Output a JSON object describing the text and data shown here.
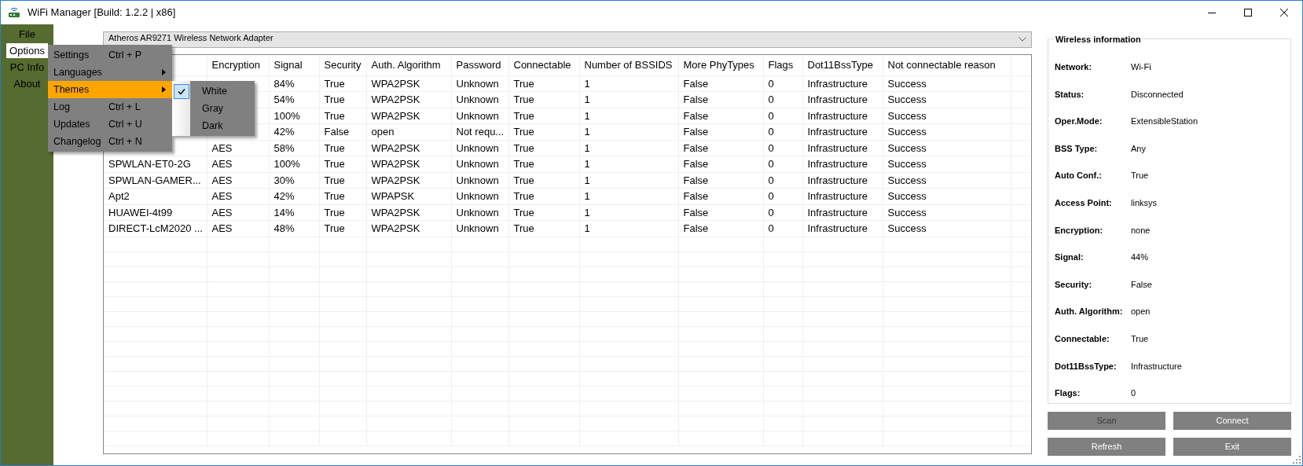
{
  "window": {
    "title": "WiFi Manager [Build: 1.2.2 | x86]"
  },
  "sidebar": {
    "items": [
      {
        "label": "File",
        "selected": false
      },
      {
        "label": "Options",
        "selected": true
      },
      {
        "label": "PC Info",
        "selected": false
      },
      {
        "label": "About",
        "selected": false
      }
    ]
  },
  "options_menu": {
    "items": [
      {
        "label": "Settings",
        "shortcut": "Ctrl + P",
        "kind": "command",
        "selected": false
      },
      {
        "label": "Languages",
        "kind": "submenu",
        "selected": false
      },
      {
        "label": "Themes",
        "kind": "submenu",
        "selected": true
      },
      {
        "label": "Log",
        "shortcut": "Ctrl + L",
        "kind": "command",
        "selected": false
      },
      {
        "label": "Updates",
        "shortcut": "Ctrl + U",
        "kind": "command",
        "selected": false
      },
      {
        "label": "Changelog",
        "shortcut": "Ctrl + N",
        "kind": "command",
        "selected": false
      }
    ]
  },
  "themes_submenu": {
    "items": [
      {
        "label": "White",
        "checked": true
      },
      {
        "label": "Gray",
        "checked": false
      },
      {
        "label": "Dark",
        "checked": false
      }
    ]
  },
  "adapter_dropdown": {
    "value": "Atheros AR9271 Wireless Network Adapter"
  },
  "table": {
    "columns": [
      {},
      {
        "label": "Encryption"
      },
      {
        "label": "Signal"
      },
      {
        "label": "Security"
      },
      {
        "label": "Auth. Algorithm"
      },
      {
        "label": "Password"
      },
      {
        "label": "Connectable"
      },
      {
        "label": "Number of BSSIDS"
      },
      {
        "label": "More PhyTypes"
      },
      {
        "label": "Flags"
      },
      {
        "label": "Dot11BssType"
      },
      {
        "label": "Not connectable reason"
      }
    ],
    "rows": [
      {
        "cells": [
          null,
          null,
          "84%",
          "True",
          "WPA2PSK",
          "Unknown",
          "True",
          "1",
          "False",
          "0",
          "Infrastructure",
          "Success"
        ]
      },
      {
        "cells": [
          null,
          null,
          "54%",
          "True",
          "WPA2PSK",
          "Unknown",
          "True",
          "1",
          "False",
          "0",
          "Infrastructure",
          "Success"
        ]
      },
      {
        "cells": [
          null,
          null,
          "100%",
          "True",
          "WPA2PSK",
          "Unknown",
          "True",
          "1",
          "False",
          "0",
          "Infrastructure",
          "Success"
        ]
      },
      {
        "cells": [
          null,
          null,
          "42%",
          "False",
          "open",
          "Not requ...",
          "True",
          "1",
          "False",
          "0",
          "Infrastructure",
          "Success"
        ]
      },
      {
        "cells": [
          null,
          "AES",
          "58%",
          "True",
          "WPA2PSK",
          "Unknown",
          "True",
          "1",
          "False",
          "0",
          "Infrastructure",
          "Success"
        ]
      },
      {
        "cells": [
          "SPWLAN-ET0-2G",
          "AES",
          "100%",
          "True",
          "WPA2PSK",
          "Unknown",
          "True",
          "1",
          "False",
          "0",
          "Infrastructure",
          "Success"
        ]
      },
      {
        "cells": [
          "SPWLAN-GAMER...",
          "AES",
          "30%",
          "True",
          "WPA2PSK",
          "Unknown",
          "True",
          "1",
          "False",
          "0",
          "Infrastructure",
          "Success"
        ]
      },
      {
        "cells": [
          "Apt2",
          "AES",
          "42%",
          "True",
          "WPAPSK",
          "Unknown",
          "True",
          "1",
          "False",
          "0",
          "Infrastructure",
          "Success"
        ]
      },
      {
        "cells": [
          "HUAWEI-4t99",
          "AES",
          "14%",
          "True",
          "WPA2PSK",
          "Unknown",
          "True",
          "1",
          "False",
          "0",
          "Infrastructure",
          "Success"
        ]
      },
      {
        "cells": [
          "DIRECT-LcM2020 ...",
          "AES",
          "48%",
          "True",
          "WPA2PSK",
          "Unknown",
          "True",
          "1",
          "False",
          "0",
          "Infrastructure",
          "Success"
        ]
      }
    ]
  },
  "wireless_info": {
    "title": "Wireless information",
    "fields": [
      {
        "label": "Network:",
        "value": "Wi-Fi"
      },
      {
        "label": "Status:",
        "value": "Disconnected"
      },
      {
        "label": "Oper.Mode:",
        "value": "ExtensibleStation"
      },
      {
        "label": "BSS Type:",
        "value": "Any"
      },
      {
        "label": "Auto Conf.:",
        "value": "True"
      },
      {
        "label": "Access Point:",
        "value": "linksys"
      },
      {
        "label": "Encryption:",
        "value": "none"
      },
      {
        "label": "Signal:",
        "value": "44%"
      },
      {
        "label": "Security:",
        "value": "False"
      },
      {
        "label": "Auth. Algorithm:",
        "value": "open"
      },
      {
        "label": "Connectable:",
        "value": "True"
      },
      {
        "label": "Dot11BssType:",
        "value": "Infrastructure"
      },
      {
        "label": "Flags:",
        "value": "0"
      }
    ]
  },
  "buttons": [
    {
      "label": "Scan",
      "disabled": true
    },
    {
      "label": "Connect",
      "disabled": false
    },
    {
      "label": "Refresh",
      "disabled": false
    },
    {
      "label": "Exit",
      "disabled": false
    }
  ]
}
